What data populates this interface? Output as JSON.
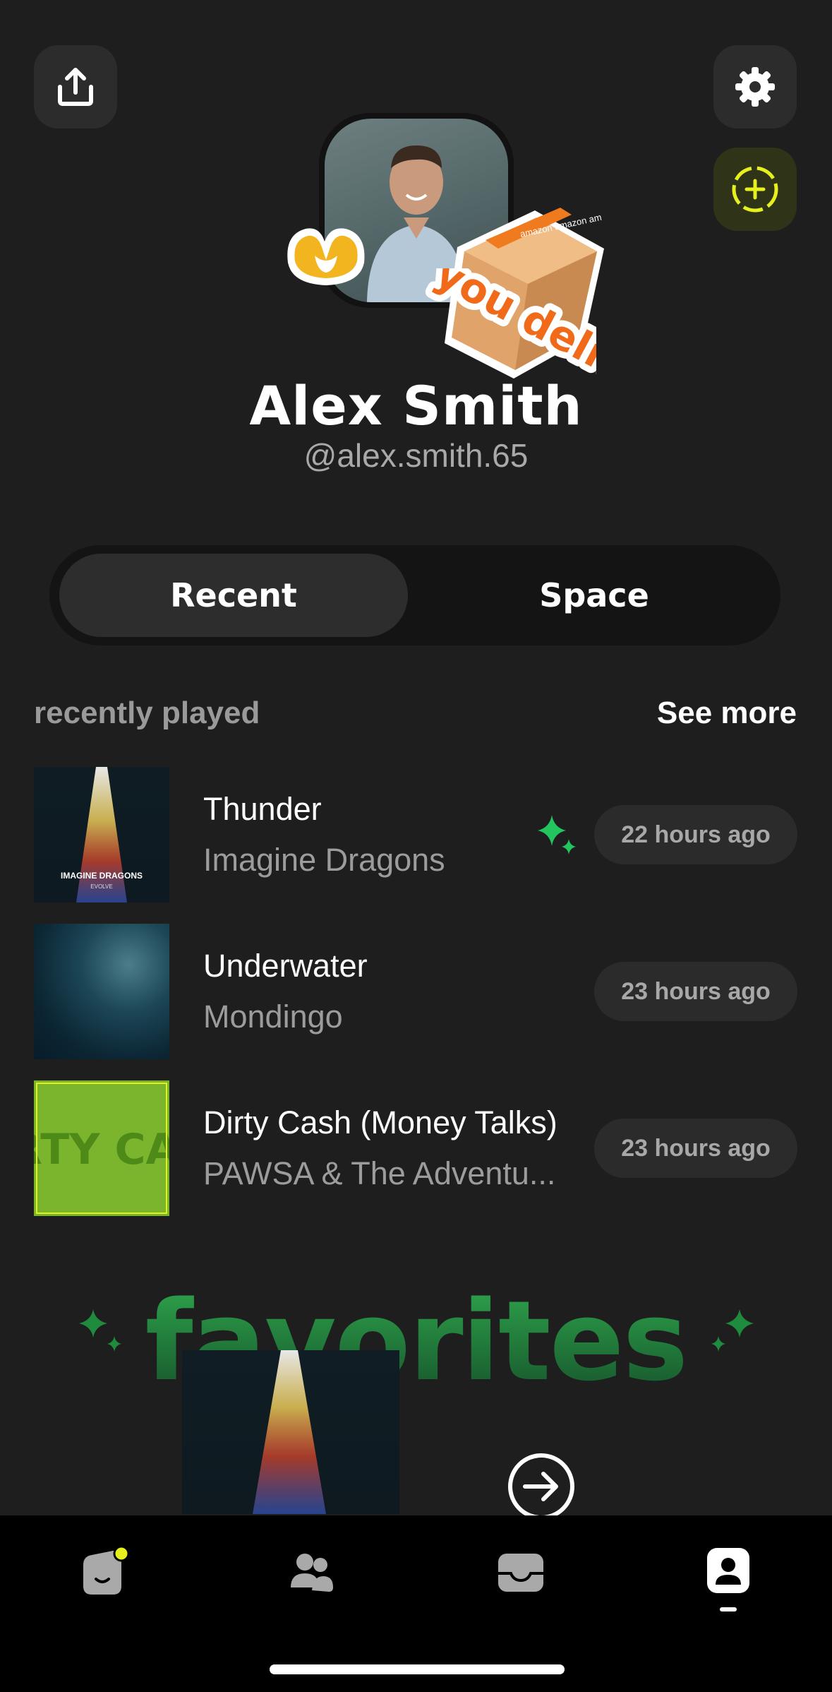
{
  "profile": {
    "name": "Alex Smith",
    "handle": "@alex.smith.65",
    "sticker_text": "you delivered",
    "box_brand": "amazon amazon am"
  },
  "tabs": {
    "recent": "Recent",
    "space": "Space"
  },
  "recent": {
    "title": "recently played",
    "see_more": "See more",
    "items": [
      {
        "title": "Thunder",
        "artist": "Imagine Dragons",
        "time": "22 hours ago",
        "cover_text": "IMAGINE DRAGONS",
        "cover_subtext": "EVOLVE"
      },
      {
        "title": "Underwater",
        "artist": "Mondingo",
        "time": "23 hours ago"
      },
      {
        "title": "Dirty Cash (Money Talks)",
        "artist": "PAWSA & The Adventu...",
        "time": "23 hours ago",
        "cover_text": "DIRTY CASH"
      }
    ]
  },
  "favorites": {
    "title": "favorites"
  },
  "colors": {
    "accent_green": "#22c55e",
    "accent_yellow": "#e6f01e",
    "background": "#1e1e1e"
  }
}
